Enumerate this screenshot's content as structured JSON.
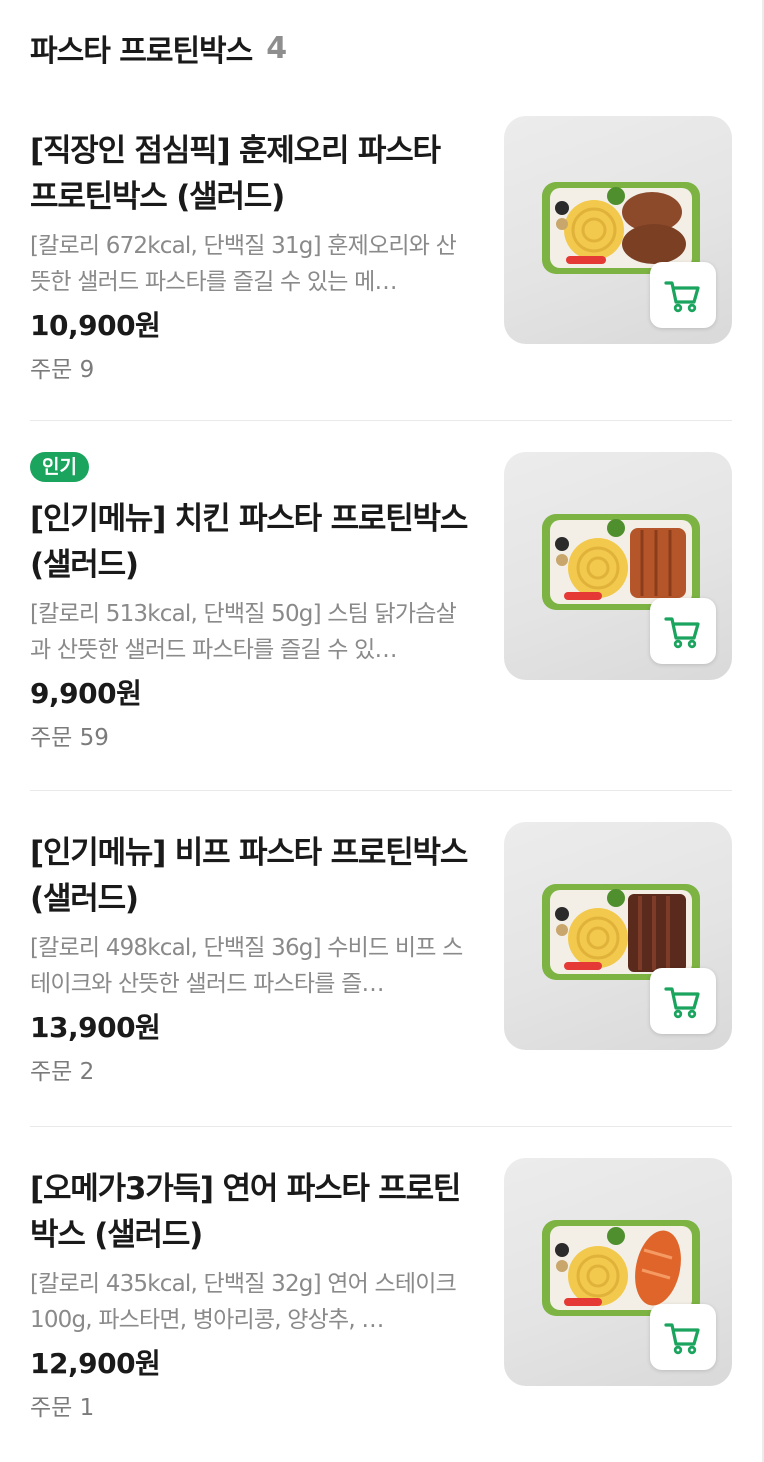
{
  "section": {
    "title": "파스타 프로틴박스",
    "count": "4"
  },
  "items": [
    {
      "badge": "",
      "name": "[직장인 점심픽] 훈제오리 파스타 프로틴박스 (샐러드)",
      "desc": "[칼로리 672kcal, 단백질 31g] 훈제오리와 산뜻한 샐러드 파스타를 즐길 수 있는 메…",
      "price": "10,900원",
      "orders": "주문 9",
      "protein": "duck"
    },
    {
      "badge": "인기",
      "name": "[인기메뉴] 치킨 파스타 프로틴박스 (샐러드)",
      "desc": "[칼로리 513kcal, 단백질 50g] 스팀 닭가슴살과 산뜻한 샐러드 파스타를 즐길 수 있…",
      "price": "9,900원",
      "orders": "주문 59",
      "protein": "chicken"
    },
    {
      "badge": "",
      "name": "[인기메뉴] 비프 파스타 프로틴박스 (샐러드)",
      "desc": "[칼로리 498kcal, 단백질 36g] 수비드 비프 스테이크와 산뜻한 샐러드 파스타를 즐…",
      "price": "13,900원",
      "orders": "주문 2",
      "protein": "beef"
    },
    {
      "badge": "",
      "name": "[오메가3가득] 연어 파스타 프로틴박스 (샐러드)",
      "desc": "[칼로리 435kcal, 단백질 32g] 연어 스테이크 100g, 파스타면, 병아리콩, 양상추, …",
      "price": "12,900원",
      "orders": "주문 1",
      "protein": "salmon"
    }
  ],
  "colors": {
    "accent": "#1aa45e",
    "cart_icon": "#1aa45e",
    "muted_text": "#8a8a8a"
  },
  "icons": {
    "cart": "shopping-cart-icon"
  }
}
